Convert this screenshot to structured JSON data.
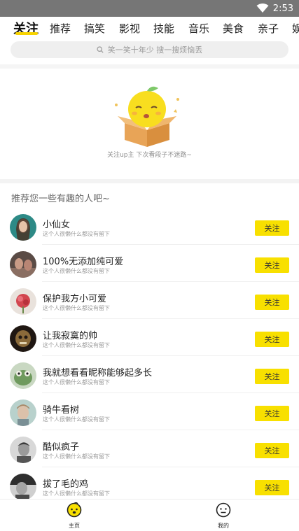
{
  "status_bar": {
    "time": "2:53"
  },
  "tabs": [
    {
      "label": "关注",
      "active": true
    },
    {
      "label": "推荐"
    },
    {
      "label": "搞笑"
    },
    {
      "label": "影视"
    },
    {
      "label": "技能"
    },
    {
      "label": "音乐"
    },
    {
      "label": "美食"
    },
    {
      "label": "亲子"
    },
    {
      "label": "娱"
    }
  ],
  "search": {
    "placeholder": "笑一笑十年少 搜一搜烦恼丢"
  },
  "empty_state": {
    "text": "关注up主 下次看段子不迷路~"
  },
  "recommend": {
    "title": "推荐您一些有趣的人吧~",
    "follow_label": "关注",
    "users": [
      {
        "name": "小仙女",
        "desc": "这个人很懒什么都没有留下"
      },
      {
        "name": "100%无添加纯可爱",
        "desc": "这个人很懒什么都没有留下"
      },
      {
        "name": "保护我方小可爱",
        "desc": "这个人很懒什么都没有留下"
      },
      {
        "name": "让我寂寞的帅",
        "desc": "这个人很懒什么都没有留下"
      },
      {
        "name": "我就想看看昵称能够起多长",
        "desc": "这个人很懒什么都没有留下"
      },
      {
        "name": "骑牛看树",
        "desc": "这个人很懒什么都没有留下"
      },
      {
        "name": "酷似疯子",
        "desc": "这个人很懒什么都没有留下"
      },
      {
        "name": "拔了毛的鸡",
        "desc": "这个人很懒什么都没有留下"
      }
    ]
  },
  "bottom_nav": [
    {
      "label": "主页",
      "icon": "home-face-icon",
      "active": true
    },
    {
      "label": "我的",
      "icon": "profile-face-icon"
    }
  ],
  "colors": {
    "accent": "#f8e000",
    "status_bar": "#767676"
  }
}
